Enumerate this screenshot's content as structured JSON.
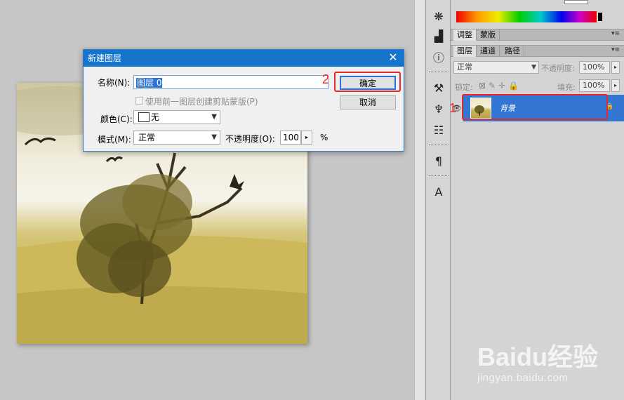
{
  "dialog": {
    "title": "新建图层",
    "name_label": "名称(N):",
    "name_value": "图层 0",
    "clip_checkbox_label": "使用前一图层创建剪贴蒙版(P)",
    "color_label": "颜色(C):",
    "color_value": "无",
    "mode_label": "模式(M):",
    "mode_value": "正常",
    "opacity_label": "不透明度(O):",
    "opacity_value": "100",
    "opacity_unit": "%",
    "ok_label": "确定",
    "cancel_label": "取消"
  },
  "panels": {
    "adjust_tabs": [
      "调整",
      "蒙版"
    ],
    "layer_tabs": [
      "图层",
      "通道",
      "路径"
    ],
    "blend_mode": "正常",
    "opacity_label": "不透明度:",
    "opacity_value": "100%",
    "lock_label": "锁定:",
    "fill_label": "填充:",
    "fill_value": "100%",
    "layer_name": "背景"
  },
  "annotations": {
    "step1": "1",
    "step2": "2",
    "color": "#e42a2a"
  },
  "watermark": {
    "logo": "Baidu经验",
    "url": "jingyan.baidu.com"
  },
  "icons": [
    "sun-wheel-icon",
    "histogram-icon",
    "info-icon",
    "tools-preset-icon",
    "clone-source-icon",
    "stamp-icon",
    "paragraph-icon",
    "character-icon",
    "eye-icon",
    "lock-icon",
    "close-icon"
  ]
}
